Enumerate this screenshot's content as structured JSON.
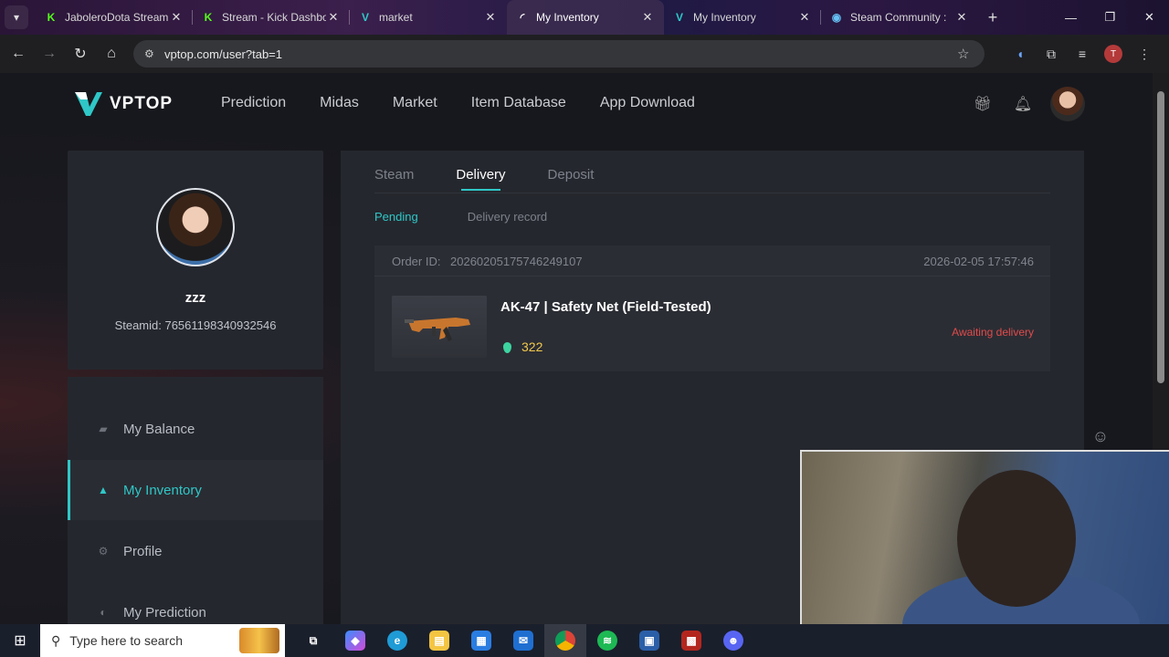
{
  "browser": {
    "tabs": [
      {
        "title": "JaboleroDota Stream",
        "favicon": "kick-icon",
        "color": "#53fc18",
        "active": false
      },
      {
        "title": "Stream - Kick Dashbo",
        "favicon": "kick-icon",
        "color": "#53fc18",
        "active": false
      },
      {
        "title": "market",
        "favicon": "vptop-icon",
        "color": "#2fc7c7",
        "active": false
      },
      {
        "title": "My Inventory",
        "favicon": "loading-icon",
        "color": "#dddddd",
        "active": true
      },
      {
        "title": "My Inventory",
        "favicon": "vptop-icon",
        "color": "#2fc7c7",
        "active": false
      },
      {
        "title": "Steam Community :",
        "favicon": "steam-icon",
        "color": "#66c0f4",
        "active": false
      }
    ],
    "url": "vptop.com/user?tab=1",
    "profile_initial": "T"
  },
  "site": {
    "logo_text": "VPTOP",
    "nav": [
      "Prediction",
      "Midas",
      "Market",
      "Item Database",
      "App Download"
    ]
  },
  "profile": {
    "name": "zzz",
    "steamid": "Steamid: 76561198340932546"
  },
  "sidebar": {
    "items": [
      {
        "label": "My Balance",
        "icon": "wallet-icon",
        "active": false
      },
      {
        "label": "My Inventory",
        "icon": "inventory-icon",
        "active": true
      },
      {
        "label": "Profile",
        "icon": "gear-icon",
        "active": false
      },
      {
        "label": "My Prediction",
        "icon": "prediction-icon",
        "active": false
      }
    ]
  },
  "main": {
    "tabs": [
      {
        "label": "Steam",
        "active": false
      },
      {
        "label": "Delivery",
        "active": true
      },
      {
        "label": "Deposit",
        "active": false
      }
    ],
    "subtabs": [
      {
        "label": "Pending",
        "active": true
      },
      {
        "label": "Delivery record",
        "active": false
      }
    ],
    "order": {
      "id_label": "Order ID:",
      "id": "20260205175746249107",
      "date": "2026-02-05 17:57:46",
      "item_name": "AK-47 | Safety Net (Field-Tested)",
      "price": "322",
      "status": "Awaiting delivery"
    }
  },
  "taskbar": {
    "search_placeholder": "Type here to search"
  },
  "colors": {
    "accent": "#2fc7c7",
    "status_awaiting": "#e04b4b",
    "price": "#f2c94c"
  }
}
